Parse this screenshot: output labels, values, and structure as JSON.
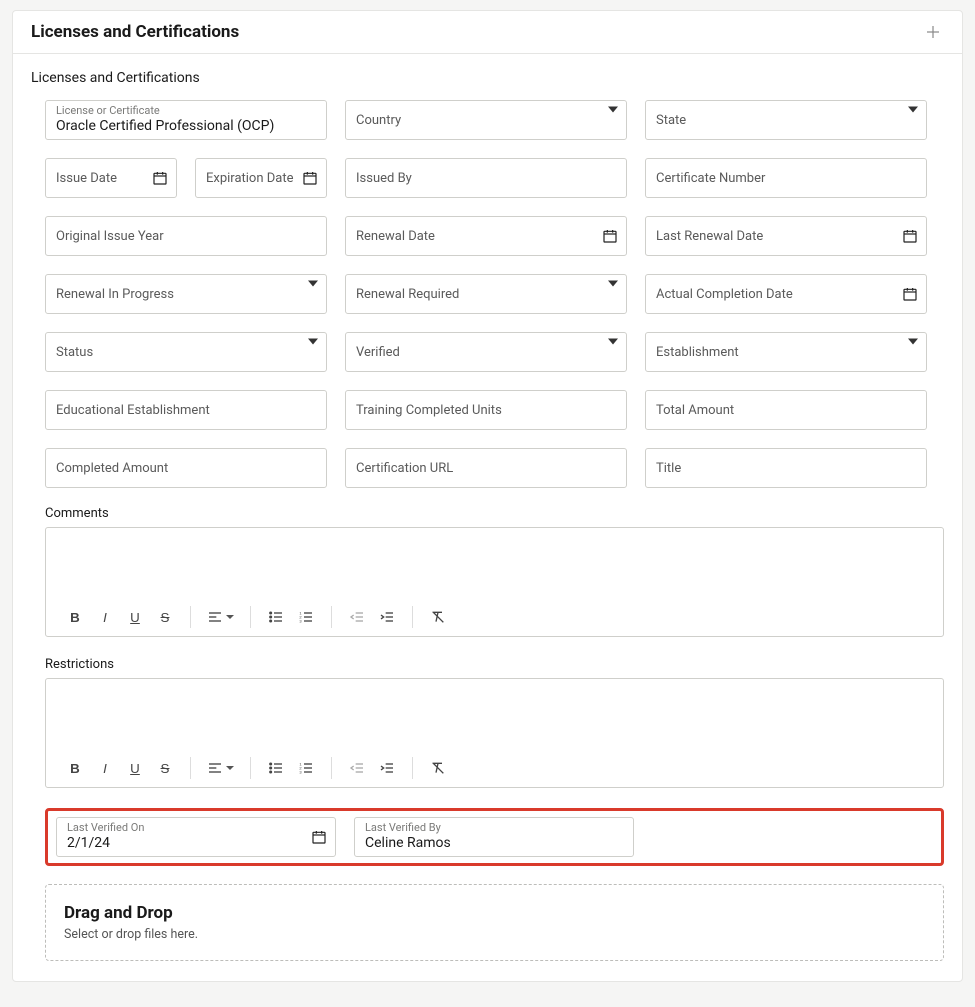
{
  "header": {
    "title": "Licenses and Certifications"
  },
  "section": {
    "title": "Licenses and Certifications"
  },
  "fields": {
    "license_label": "License or Certificate",
    "license_value": "Oracle Certified Professional (OCP)",
    "country": "Country",
    "state": "State",
    "issue_date": "Issue Date",
    "expiration_date": "Expiration Date",
    "issued_by": "Issued By",
    "certificate_number": "Certificate Number",
    "original_issue_year": "Original Issue Year",
    "renewal_date": "Renewal Date",
    "last_renewal_date": "Last Renewal Date",
    "renewal_in_progress": "Renewal In Progress",
    "renewal_required": "Renewal Required",
    "actual_completion_date": "Actual Completion Date",
    "status": "Status",
    "verified": "Verified",
    "establishment": "Establishment",
    "educational_establishment": "Educational Establishment",
    "training_completed_units": "Training Completed Units",
    "total_amount": "Total Amount",
    "completed_amount": "Completed Amount",
    "certification_url": "Certification URL",
    "title_field": "Title",
    "comments_label": "Comments",
    "restrictions_label": "Restrictions",
    "last_verified_on_label": "Last Verified On",
    "last_verified_on_value": "2/1/24",
    "last_verified_by_label": "Last Verified By",
    "last_verified_by_value": "Celine Ramos"
  },
  "dropzone": {
    "title": "Drag and Drop",
    "subtitle": "Select or drop files here."
  }
}
